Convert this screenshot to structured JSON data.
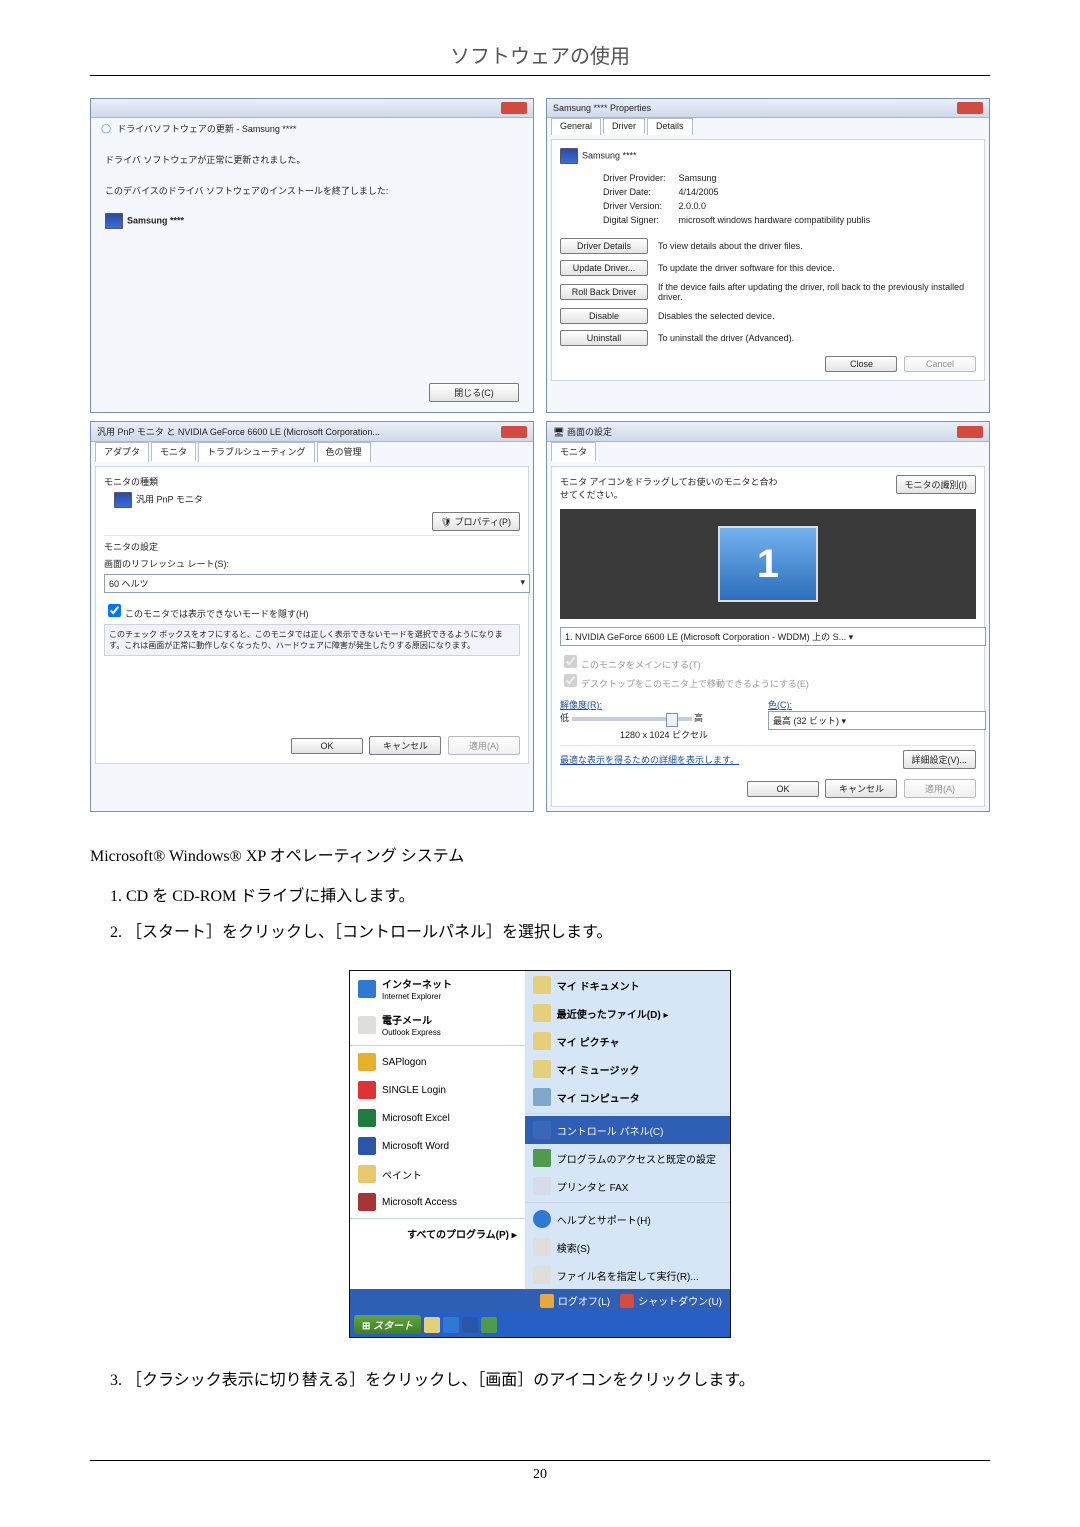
{
  "page": {
    "title": "ソフトウェアの使用",
    "number": "20"
  },
  "wizard": {
    "breadcrumb": "ドライバソフトウェアの更新 - Samsung ****",
    "status": "ドライバ ソフトウェアが正常に更新されました。",
    "device_line": "このデバイスのドライバ ソフトウェアのインストールを終了しました:",
    "device": "Samsung ****",
    "close": "閉じる(C)"
  },
  "driver_props": {
    "title": "Samsung **** Properties",
    "tabs": {
      "general": "General",
      "driver": "Driver",
      "details": "Details"
    },
    "device": "Samsung ****",
    "rows": {
      "provider_l": "Driver Provider:",
      "provider_v": "Samsung",
      "date_l": "Driver Date:",
      "date_v": "4/14/2005",
      "version_l": "Driver Version:",
      "version_v": "2.0.0.0",
      "signer_l": "Digital Signer:",
      "signer_v": "microsoft windows hardware compatibility publis"
    },
    "btns": {
      "details": "Driver Details",
      "details_d": "To view details about the driver files.",
      "update": "Update Driver...",
      "update_d": "To update the driver software for this device.",
      "rollback": "Roll Back Driver",
      "rollback_d": "If the device fails after updating the driver, roll back to the previously installed driver.",
      "disable": "Disable",
      "disable_d": "Disables the selected device.",
      "uninstall": "Uninstall",
      "uninstall_d": "To uninstall the driver (Advanced)."
    },
    "footer": {
      "close": "Close",
      "cancel": "Cancel"
    }
  },
  "monitor_props": {
    "title": "汎用 PnP モニタ と NVIDIA GeForce 6600 LE (Microsoft Corporation...",
    "tabs": {
      "adapter": "アダプタ",
      "monitor": "モニタ",
      "ts": "トラブルシューティング",
      "color": "色の管理"
    },
    "sec_type": "モニタの種類",
    "device": "汎用 PnP モニタ",
    "btn_prop": "プロパティ(P)",
    "sec_set": "モニタの設定",
    "refresh_l": "画面のリフレッシュ レート(S):",
    "refresh_v": "60 ヘルツ",
    "cb_hide": "このモニタでは表示できないモードを隠す(H)",
    "cb_note": "このチェック ボックスをオフにすると、このモニタでは正しく表示できないモードを選択できるようになります。これは画面が正常に動作しなくなったり、ハードウェアに障害が発生したりする原因になります。",
    "footer": {
      "ok": "OK",
      "cancel": "キャンセル",
      "apply": "適用(A)"
    }
  },
  "display": {
    "title": "画面の設定",
    "tab": "モニタ",
    "hint": "モニタ アイコンをドラッグしてお使いのモニタと合わせてください。",
    "identify": "モニタの識別(I)",
    "dropdown": "1. NVIDIA GeForce 6600 LE (Microsoft Corporation - WDDM) 上の S... ▾",
    "cb_main": "このモニタをメインにする(T)",
    "cb_ext": "デスクトップをこのモニタ上で移動できるようにする(E)",
    "res_l": "解像度(R):",
    "color_l": "色(C):",
    "lo": "低",
    "hi": "高",
    "color_v": "最高 (32 ビット)  ▾",
    "res_v": "1280 x 1024 ピクセル",
    "adv_link": "最適な表示を得るための詳細を表示します。",
    "adv_btn": "詳細設定(V)...",
    "footer": {
      "ok": "OK",
      "cancel": "キャンセル",
      "apply": "適用(A)"
    }
  },
  "body_text": {
    "os": "Microsoft® Windows® XP オペレーティング システム",
    "step1": "CD を CD-ROM ドライブに挿入します。",
    "step2": "［スタート］をクリックし、［コントロールパネル］を選択します。",
    "step3": "［クラシック表示に切り替える］をクリックし、［画面］のアイコンをクリックします。"
  },
  "startmenu": {
    "left": {
      "ie": "インターネット",
      "ie_sub": "Internet Explorer",
      "mail": "電子メール",
      "mail_sub": "Outlook Express",
      "sap": "SAPlogon",
      "single": "SINGLE Login",
      "excel": "Microsoft Excel",
      "word": "Microsoft Word",
      "paint": "ペイント",
      "access": "Microsoft Access",
      "all": "すべてのプログラム(P) ▸"
    },
    "right": {
      "docs": "マイ ドキュメント",
      "recent": "最近使ったファイル(D)",
      "pics": "マイ ピクチャ",
      "music": "マイ ミュージック",
      "comp": "マイ コンピュータ",
      "cp": "コントロール パネル(C)",
      "prog": "プログラムのアクセスと既定の設定",
      "fax": "プリンタと FAX",
      "help": "ヘルプとサポート(H)",
      "search": "検索(S)",
      "run": "ファイル名を指定して実行(R)..."
    },
    "footer": {
      "logoff": "ログオフ(L)",
      "shutdown": "シャットダウン(U)"
    },
    "start": "スタート"
  }
}
